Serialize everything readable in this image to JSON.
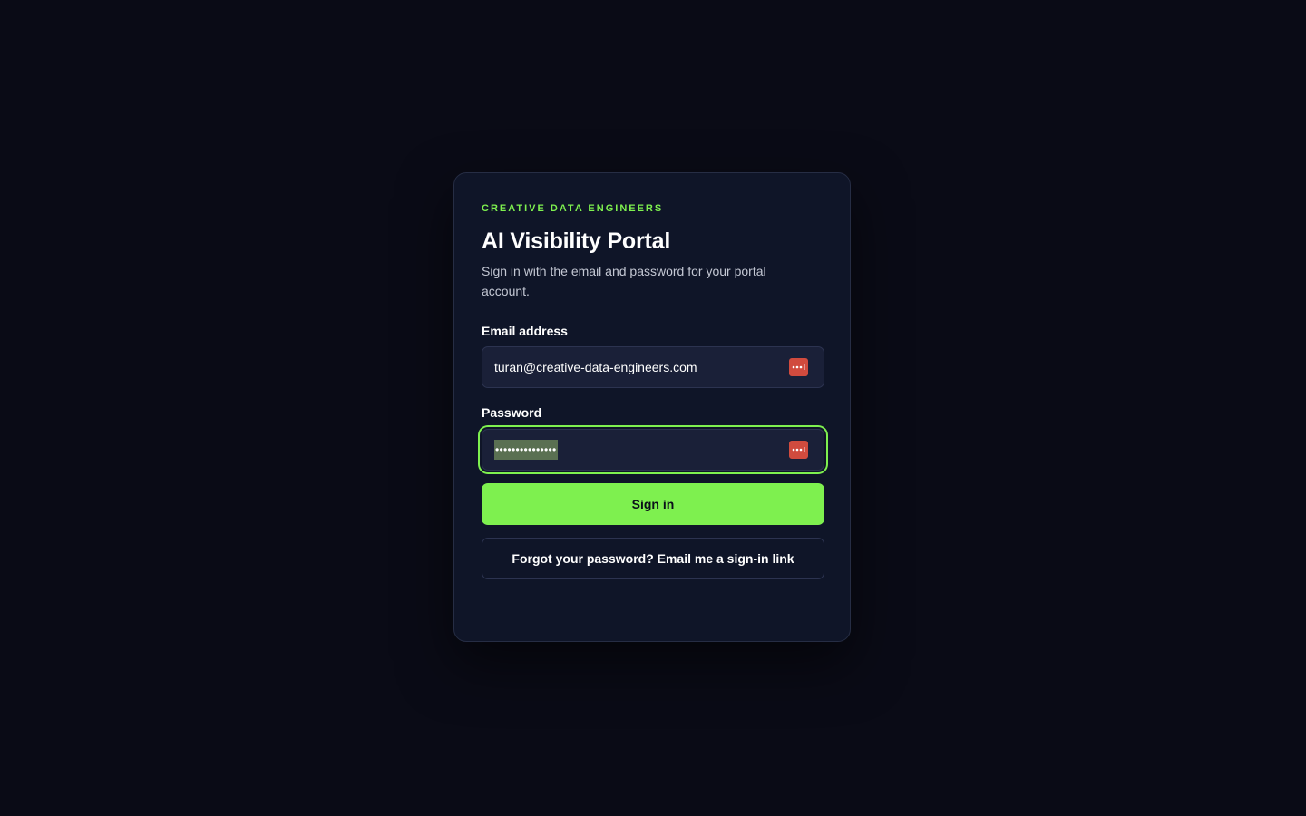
{
  "brand": {
    "eyebrow": "CREATIVE DATA ENGINEERS",
    "accent_color": "#7ef04f"
  },
  "header": {
    "title": "AI Visibility Portal",
    "subtitle": "Sign in with the email and password for your portal account."
  },
  "form": {
    "email": {
      "label": "Email address",
      "value": "turan@creative-data-engineers.com",
      "autofill_icon": "password-manager-icon"
    },
    "password": {
      "label": "Password",
      "masked_value": "•••••••••••••••",
      "focused": true,
      "autofill_icon": "password-manager-icon"
    },
    "submit_label": "Sign in",
    "magic_link_label": "Forgot your password? Email me a sign-in link"
  },
  "colors": {
    "background": "#0a0b16",
    "card": "#0f1528",
    "field": "#1a2038",
    "password_manager_badge": "#d14b3e"
  }
}
